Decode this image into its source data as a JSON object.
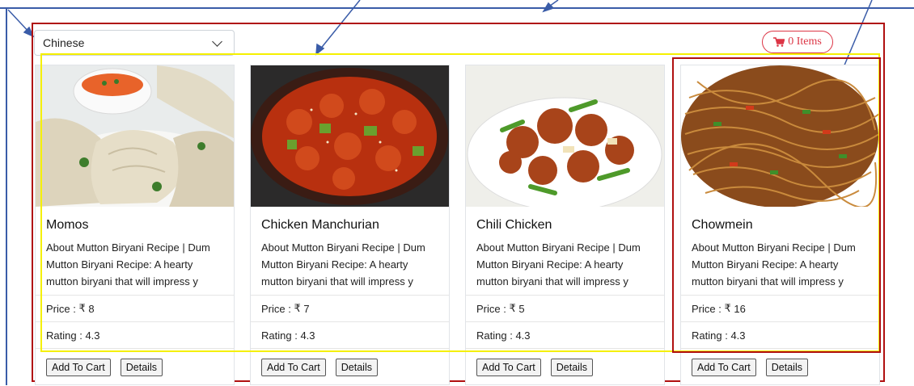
{
  "filter": {
    "selected": "Chinese"
  },
  "cart": {
    "label": "0 Items"
  },
  "currency": "₹",
  "price_label": "Price : ",
  "rating_label": "Rating : ",
  "add_label": "Add To Cart",
  "details_label": "Details",
  "colors": {
    "accent_red": "#dc3545",
    "frame_red": "#b01010",
    "highlight_yellow": "#f5f000",
    "arrow_blue": "#3a5ca8"
  },
  "products": [
    {
      "name": "Momos",
      "desc": "About Mutton Biryani Recipe | Dum Mutton Biryani Recipe: A hearty mutton biryani that will impress y",
      "price": "8",
      "rating": "4.3"
    },
    {
      "name": "Chicken Manchurian",
      "desc": "About Mutton Biryani Recipe | Dum Mutton Biryani Recipe: A hearty mutton biryani that will impress y",
      "price": "7",
      "rating": "4.3"
    },
    {
      "name": "Chili Chicken",
      "desc": "About Mutton Biryani Recipe | Dum Mutton Biryani Recipe: A hearty mutton biryani that will impress y",
      "price": "5",
      "rating": "4.3"
    },
    {
      "name": "Chowmein",
      "desc": "About Mutton Biryani Recipe | Dum Mutton Biryani Recipe: A hearty mutton biryani that will impress y",
      "price": "16",
      "rating": "4.3"
    }
  ]
}
